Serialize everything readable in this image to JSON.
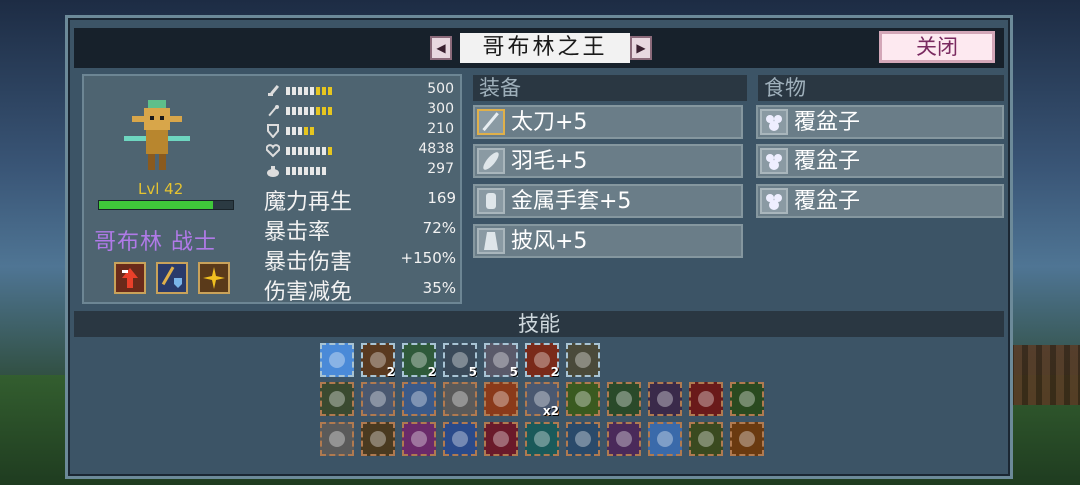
{
  "title": "哥布林之王",
  "close_label": "关闭",
  "prev_label": "◀",
  "next_label": "▶",
  "character": {
    "level": "Lvl 42",
    "name": "哥布林 战士",
    "hp_fraction": 0.85,
    "stats": [
      {
        "icon": "sword-icon",
        "value": "500",
        "bars": 8,
        "yellow": 3
      },
      {
        "icon": "wand-icon",
        "value": "300",
        "bars": 8,
        "yellow": 3
      },
      {
        "icon": "shield-icon",
        "value": "210",
        "bars": 5,
        "yellow": 2
      },
      {
        "icon": "heart-icon",
        "value": "4838",
        "bars": 8,
        "yellow": 1
      },
      {
        "icon": "speed-icon",
        "value": "297",
        "bars": 7,
        "yellow": 0
      }
    ],
    "secondary": [
      {
        "label": "魔力再生",
        "value": "169"
      },
      {
        "label": "暴击率",
        "value": "72%"
      },
      {
        "label": "暴击伤害",
        "value": "+150%"
      },
      {
        "label": "伤害减免",
        "value": "35%"
      }
    ],
    "traits": [
      "attack-up-icon",
      "axe-shield-icon",
      "sparkle-icon"
    ]
  },
  "equipment": {
    "heading": "装备",
    "items": [
      {
        "label": "太刀+5",
        "icon": "katana-icon"
      },
      {
        "label": "羽毛+5",
        "icon": "feather-icon"
      },
      {
        "label": "金属手套+5",
        "icon": "gauntlet-icon"
      },
      {
        "label": "披风+5",
        "icon": "cape-icon"
      }
    ]
  },
  "food": {
    "heading": "食物",
    "items": [
      {
        "label": "覆盆子",
        "icon": "raspberry-icon"
      },
      {
        "label": "覆盆子",
        "icon": "raspberry-icon"
      },
      {
        "label": "覆盆子",
        "icon": "raspberry-icon"
      }
    ]
  },
  "skills": {
    "heading": "技能",
    "row1": [
      {
        "icon": "blue-slash-icon",
        "count": "",
        "color": "#4a8ad8"
      },
      {
        "icon": "fire-arrow-icon",
        "count": "2",
        "color": "#5a3a20"
      },
      {
        "icon": "wave-icon",
        "count": "2",
        "color": "#2f5a3a"
      },
      {
        "icon": "cross-blades-icon",
        "count": "5",
        "color": "#3a4a5a"
      },
      {
        "icon": "greatsword-icon",
        "count": "5",
        "color": "#5a5a6a"
      },
      {
        "icon": "flame-orb-icon",
        "count": "2",
        "color": "#7a2a1a"
      },
      {
        "icon": "boulder-icon",
        "count": "",
        "color": "#4a4a3a"
      }
    ],
    "row2": [
      {
        "icon": "poison-heart-icon",
        "count": "",
        "color": "#3a4a30"
      },
      {
        "icon": "knight-icon",
        "count": "",
        "color": "#4a5870"
      },
      {
        "icon": "blue-fist-icon",
        "count": "",
        "color": "#3a5a8a"
      },
      {
        "icon": "grey-fist-icon",
        "count": "",
        "color": "#5a5a5a"
      },
      {
        "icon": "fire-demon-icon",
        "count": "",
        "color": "#8a3a1a"
      },
      {
        "icon": "armored-duo-icon",
        "count": "x2",
        "color": "#4a5870"
      },
      {
        "icon": "green-ring-icon",
        "count": "",
        "color": "#3a5a20"
      },
      {
        "icon": "green-heart-icon",
        "count": "",
        "color": "#2a4a2a"
      },
      {
        "icon": "purple-blade-icon",
        "count": "",
        "color": "#3a2a4a"
      },
      {
        "icon": "blood-eye-icon",
        "count": "",
        "color": "#6a1a1a"
      },
      {
        "icon": "serpent-icon",
        "count": "",
        "color": "#2a4a20"
      }
    ],
    "row3": [
      {
        "icon": "scroll-icon",
        "count": "",
        "color": "#5a5a5a"
      },
      {
        "icon": "orange-gear-icon",
        "count": "",
        "color": "#4a3a20"
      },
      {
        "icon": "pink-bolt-icon",
        "count": "",
        "color": "#6a2a6a"
      },
      {
        "icon": "blue-glove-icon",
        "count": "",
        "color": "#2a4a8a"
      },
      {
        "icon": "red-heart-icon",
        "count": "",
        "color": "#6a1a2a"
      },
      {
        "icon": "teal-crescent-icon",
        "count": "",
        "color": "#1a5a5a"
      },
      {
        "icon": "blue-gear-icon",
        "count": "",
        "color": "#2a4a6a"
      },
      {
        "icon": "purple-drop-icon",
        "count": "",
        "color": "#4a2a5a"
      },
      {
        "icon": "blue-slash-2-icon",
        "count": "",
        "color": "#3a6aaa"
      },
      {
        "icon": "leaf-gear-icon",
        "count": "",
        "color": "#3a4a20"
      },
      {
        "icon": "orange-shield-icon",
        "count": "",
        "color": "#6a3a10"
      }
    ]
  }
}
